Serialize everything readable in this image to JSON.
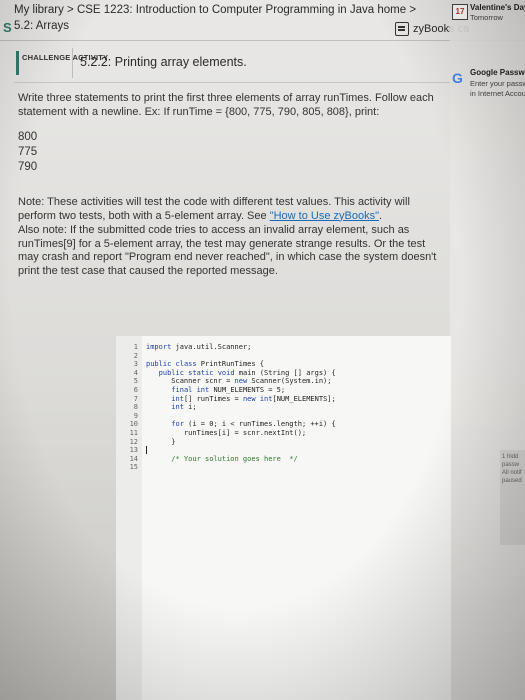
{
  "header": {
    "brand_letter": "S",
    "breadcrumb": "My library > CSE 1223: Introduction to Computer Programming in Java home >",
    "section": "5.2: Arrays",
    "zybooks_label": "zyBooks ca"
  },
  "notifications": {
    "calendar_day": "17",
    "event_title": "Valentine's Day",
    "event_when": "Tomorrow",
    "google_title": "Google Password Re",
    "google_line1": "Enter your password f",
    "google_line2": "in Internet Accounts.",
    "side_snippet": "1 hidd passw All notif paused"
  },
  "activity": {
    "badge": "CHALLENGE ACTIVITY",
    "title": "5.2.2: Printing array elements."
  },
  "instructions": {
    "main": "Write three statements to print the first three elements of array runTimes. Follow each statement with a newline. Ex: If runTime = {800, 775, 790, 805, 808}, print:",
    "outputs": [
      "800",
      "775",
      "790"
    ],
    "note_prefix": "Note: These activities will test the code with different test values. This activity will perform two tests, both with a 5-element array. See ",
    "note_link": "\"How to Use zyBooks\"",
    "note_suffix": ".",
    "also": "Also note: If the submitted code tries to access an invalid array element, such as runTimes[9] for a 5-element array, the test may generate strange results. Or the test may crash and report \"Program end never reached\", in which case the system doesn't print the test case that caused the reported message."
  },
  "editor": {
    "lines": [
      {
        "n": "1",
        "code": "import java.util.Scanner;"
      },
      {
        "n": "2",
        "code": ""
      },
      {
        "n": "3",
        "code": "public class PrintRunTimes {"
      },
      {
        "n": "4",
        "code": "   public static void main (String [] args) {"
      },
      {
        "n": "5",
        "code": "      Scanner scnr = new Scanner(System.in);"
      },
      {
        "n": "6",
        "code": "      final int NUM_ELEMENTS = 5;"
      },
      {
        "n": "7",
        "code": "      int[] runTimes = new int[NUM_ELEMENTS];"
      },
      {
        "n": "8",
        "code": "      int i;"
      },
      {
        "n": "9",
        "code": ""
      },
      {
        "n": "10",
        "code": "      for (i = 0; i < runTimes.length; ++i) {"
      },
      {
        "n": "11",
        "code": "         runTimes[i] = scnr.nextInt();"
      },
      {
        "n": "12",
        "code": "      }"
      },
      {
        "n": "13",
        "code": ""
      },
      {
        "n": "14",
        "code": "      /* Your solution goes here  */"
      },
      {
        "n": "15",
        "code": ""
      }
    ]
  },
  "colors": {
    "accent": "#2e7d6b",
    "link": "#1a6bb5",
    "keyword": "#1a3fa8",
    "comment": "#2a7a2a"
  }
}
